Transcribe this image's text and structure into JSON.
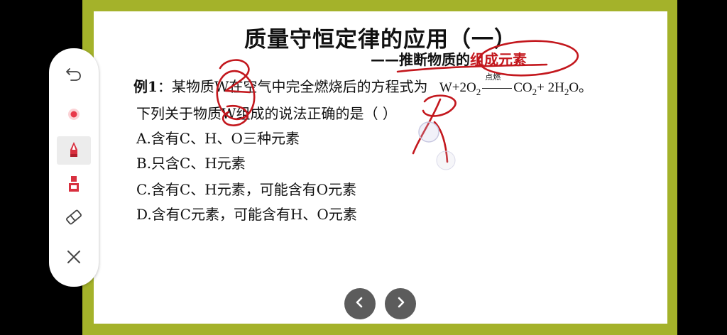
{
  "slide": {
    "title": "质量守恒定律的应用（一）",
    "subtitle_prefix": "——推断物质的",
    "subtitle_highlight": "组成元素",
    "question": {
      "label": "例1",
      "text_before": "：某物质W在空气中完全燃烧后的方程式为",
      "equation": {
        "w": "W+2O",
        "o2_sub": "2",
        "condition": "点燃",
        "co2": "CO",
        "co2_sub": "2",
        "plus_water": "+ 2H",
        "h2_sub": "2",
        "o_end": "O。"
      },
      "line2": "下列关于物质W组成的说法正确的是（   ）",
      "options": [
        "A.含有C、H、O三种元素",
        "B.只含C、H元素",
        "C.含有C、H元素，可能含有O元素",
        "D.含有C元素，可能含有H、O元素"
      ]
    }
  },
  "toolbar": {
    "tools": [
      {
        "name": "undo",
        "icon": "undo-icon"
      },
      {
        "name": "laser-pointer",
        "icon": "laser-dot-icon",
        "color": "#e8394a"
      },
      {
        "name": "pen",
        "icon": "pen-icon",
        "color": "#d8303f",
        "selected": true
      },
      {
        "name": "highlighter",
        "icon": "highlighter-icon",
        "color": "#d8303f"
      },
      {
        "name": "eraser",
        "icon": "eraser-icon"
      },
      {
        "name": "close",
        "icon": "close-icon"
      }
    ]
  },
  "navigation": {
    "prev_icon": "chevron-left-icon",
    "next_icon": "chevron-right-icon"
  },
  "colors": {
    "frame": "#a4b22a",
    "ink": "#c3171d",
    "accent": "#c3171d"
  }
}
